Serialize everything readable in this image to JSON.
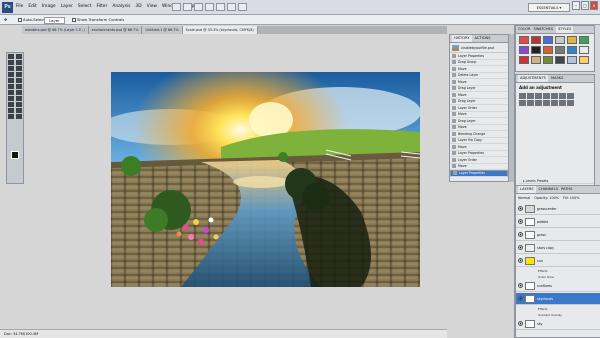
{
  "menu": [
    "File",
    "Edit",
    "Image",
    "Layer",
    "Select",
    "Filter",
    "Analysis",
    "3D",
    "View",
    "Window",
    "Help"
  ],
  "workspace": "ESSENTIALS ▾",
  "options": {
    "auto_select": "Auto-Select:",
    "target": "Layer",
    "transform": "Show Transform Controls"
  },
  "tabs": [
    "wonders.psd @ 66.7% (Layer 1 E..)",
    "environments.psd @ 66.7%",
    "Untitled-1 @ 66.7%",
    "Scale-psd @ 33.3% (skyclouds, CMYK/8)"
  ],
  "history": {
    "tabs": [
      "HISTORY",
      "ACTIONS"
    ],
    "snapshot": "visiblebyoutfile.psd",
    "items": [
      "Layer Properties",
      "Drag Group",
      "Move",
      "Delete Layer",
      "Move",
      "Drag Layer",
      "Move",
      "Drag Layer",
      "Layer Order",
      "Move",
      "Drag Layer",
      "Move",
      "Blending Change",
      "Layer Via Copy",
      "Move",
      "Layer Properties",
      "Layer Order",
      "Move",
      "Layer Properties"
    ]
  },
  "styles_tabs": [
    "COLOR",
    "SWATCHES",
    "STYLES"
  ],
  "adjustments": {
    "tabs": [
      "ADJUSTMENTS",
      "MASKS"
    ],
    "title": "Add an adjustment",
    "presets": [
      "Levels Presets",
      "Curves Presets",
      "Exposure Presets",
      "Hue/Saturation Presets",
      "Black & White Presets",
      "Channel Mixer Presets",
      "Selective Color Presets"
    ]
  },
  "layers": {
    "tabs": [
      "LAYERS",
      "CHANNELS",
      "PATHS"
    ],
    "mode": "Normal",
    "opacity": "Opacity: 100%",
    "fill": "Fill: 100%",
    "rows": [
      "grasscenter",
      "pebble",
      "grass",
      "stars copy",
      "sun",
      "sunflares",
      "skyclouds",
      "sky"
    ],
    "effects": [
      "Effects",
      "Outer Glow",
      "Effects",
      "Gradient Overlay"
    ]
  },
  "status": "Doc: 34.7M/100.4M"
}
